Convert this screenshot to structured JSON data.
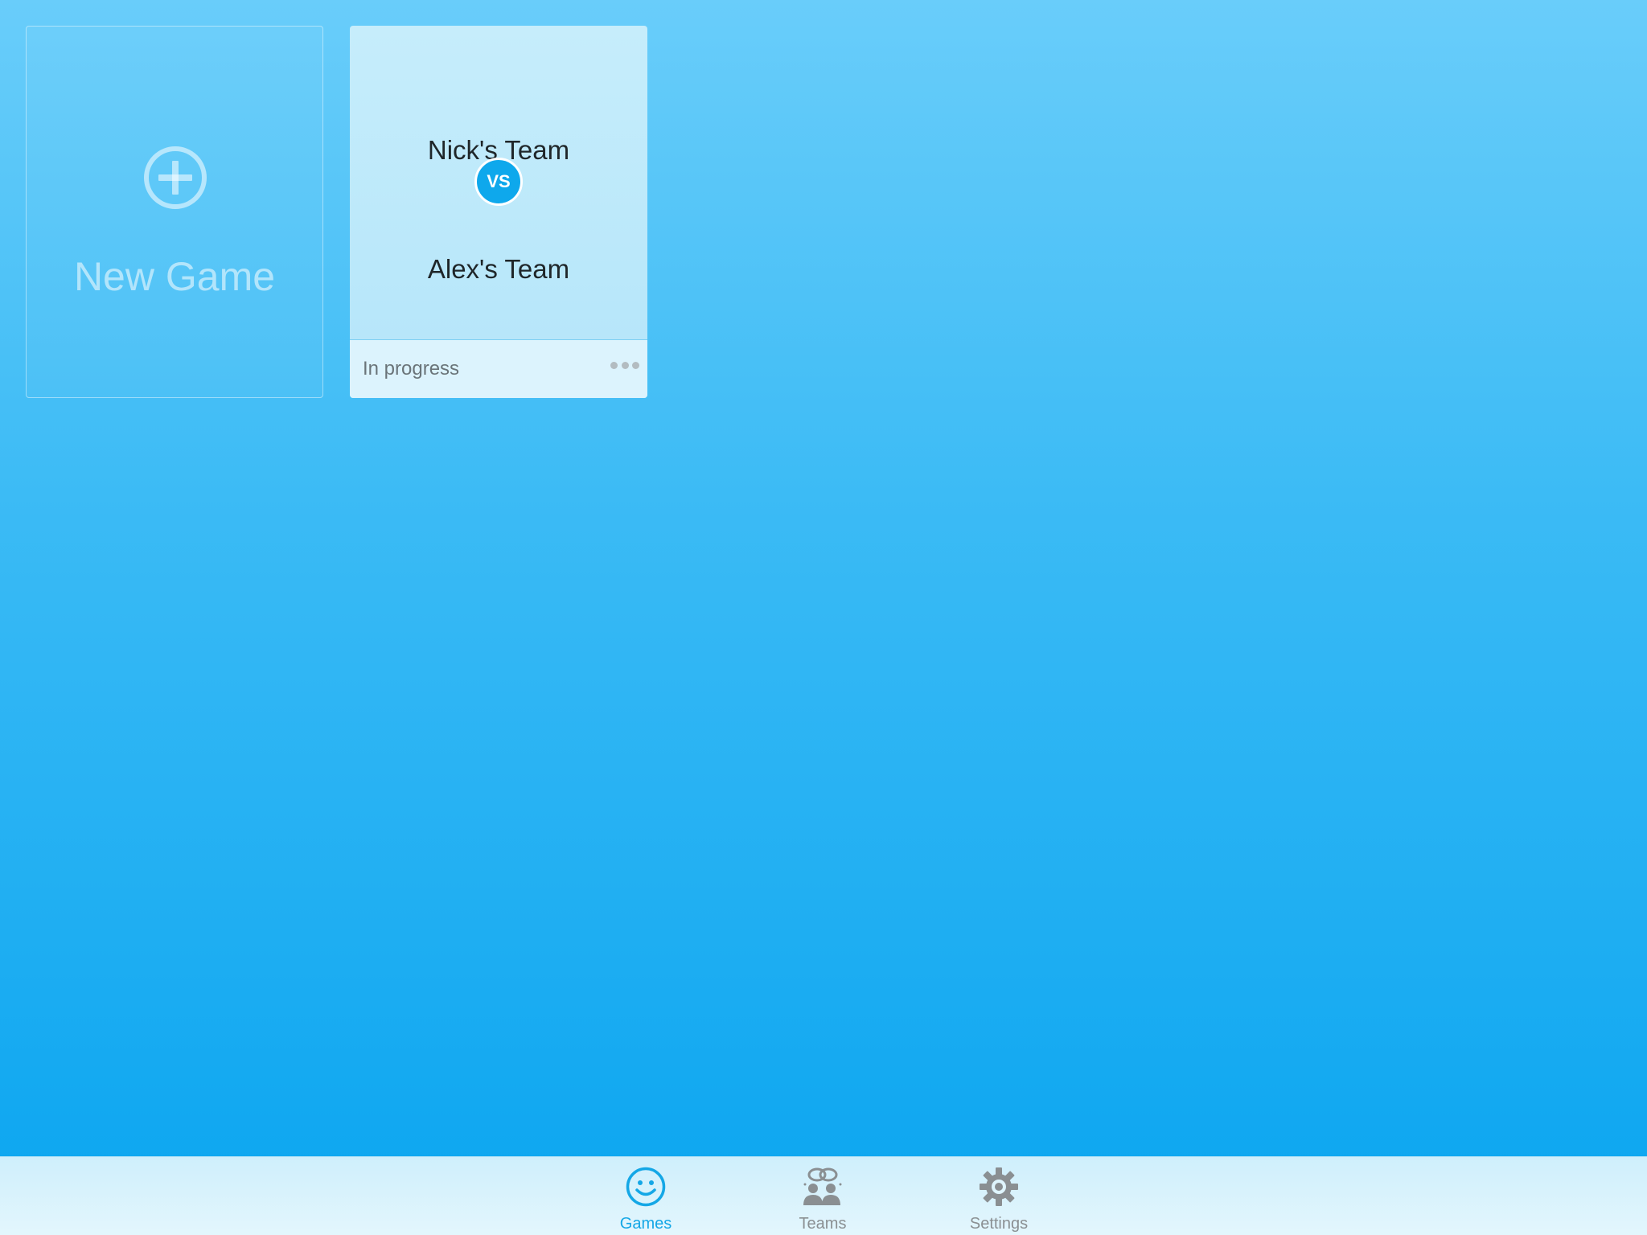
{
  "new_game": {
    "label": "New Game",
    "icon": "plus-circle-icon"
  },
  "games": [
    {
      "home_team": "Nick's Team",
      "versus": "VS",
      "away_team": "Alex's Team",
      "status": "In progress",
      "more_icon": "ellipsis-icon"
    }
  ],
  "tabbar": {
    "selected": "Games",
    "tabs": [
      {
        "label": "Games",
        "icon": "smiley-icon"
      },
      {
        "label": "Teams",
        "icon": "people-icon"
      },
      {
        "label": "Settings",
        "icon": "gear-icon"
      }
    ]
  },
  "colors": {
    "background_top": "#69cdfa",
    "background_bottom": "#0aa5f0",
    "accent": "#14a7e6",
    "vs_badge": "#0ea8ec",
    "inactive_tab": "#8a8f92"
  }
}
